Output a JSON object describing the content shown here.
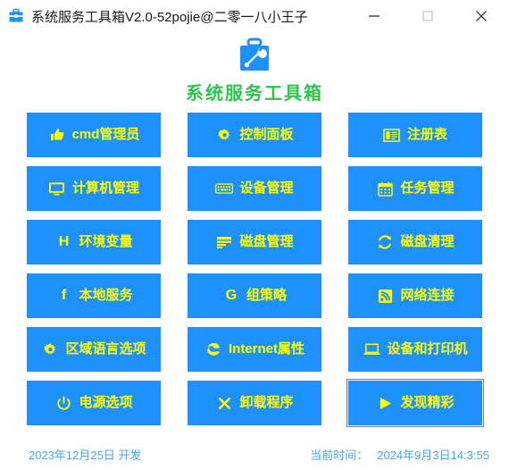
{
  "window": {
    "title": "系统服务工具箱V2.0-52pojie@二零一八小王子",
    "icon": "toolbox-icon",
    "controls": {
      "minimize": "minimize-icon",
      "maximize": "maximize-icon",
      "close": "close-icon"
    }
  },
  "header": {
    "logo_icon": "toolbox-wrench-logo",
    "app_title": "系统服务工具箱",
    "title_color": "#2fc24d"
  },
  "theme": {
    "button_bg": "#1e90ff",
    "button_text": "#ffff00",
    "footer_text": "#4aa3f5"
  },
  "buttons": [
    {
      "label": "cmd管理员",
      "icon": "thumbs-up-icon",
      "focused": false
    },
    {
      "label": "控制面板",
      "icon": "gear-icon",
      "focused": false
    },
    {
      "label": "注册表",
      "icon": "registry-book-icon",
      "focused": false
    },
    {
      "label": "计算机管理",
      "icon": "monitor-icon",
      "focused": false
    },
    {
      "label": "设备管理",
      "icon": "keyboard-icon",
      "focused": false
    },
    {
      "label": "任务管理",
      "icon": "calendar-icon",
      "focused": false
    },
    {
      "label": "环境变量",
      "icon": "letter-h-icon",
      "focused": false
    },
    {
      "label": "磁盘管理",
      "icon": "disk-bars-icon",
      "focused": false
    },
    {
      "label": "磁盘清理",
      "icon": "refresh-icon",
      "focused": false
    },
    {
      "label": "本地服务",
      "icon": "letter-f-icon",
      "focused": false
    },
    {
      "label": "组策略",
      "icon": "letter-g-icon",
      "focused": false
    },
    {
      "label": "网络连接",
      "icon": "rss-signal-icon",
      "focused": false
    },
    {
      "label": "区域语言选项",
      "icon": "gear-icon",
      "focused": false
    },
    {
      "label": "Internet属性",
      "icon": "edge-browser-icon",
      "focused": false
    },
    {
      "label": "设备和打印机",
      "icon": "laptop-icon",
      "focused": false
    },
    {
      "label": "电源选项",
      "icon": "power-icon",
      "focused": false
    },
    {
      "label": "卸载程序",
      "icon": "cross-icon",
      "focused": false
    },
    {
      "label": "发现精彩",
      "icon": "play-triangle-icon",
      "focused": true
    }
  ],
  "footer": {
    "build_info": "2023年12月25日 开发",
    "time_label": "当前时间：",
    "current_time": "2024年9月3日14:3:55"
  }
}
